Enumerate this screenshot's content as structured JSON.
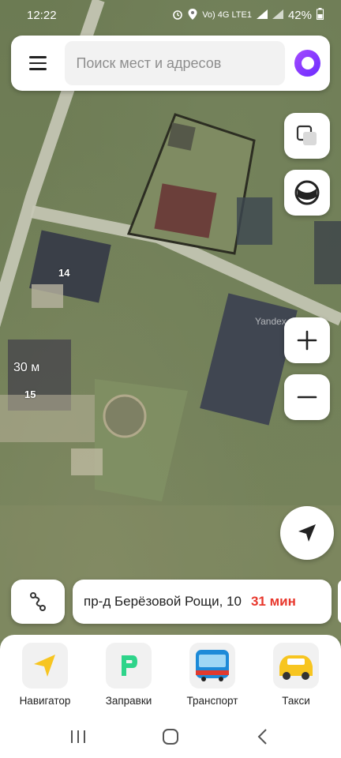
{
  "status_bar": {
    "time": "12:22",
    "network": "Vo) 4G LTE1",
    "battery": "42%"
  },
  "search": {
    "placeholder": "Поиск мест и адресов"
  },
  "map": {
    "house_labels": [
      "14",
      "15"
    ],
    "scale": "30 м",
    "watermark": "Yandex"
  },
  "route": {
    "destination": "пр-д Берёзовой Рощи, 10",
    "eta": "31 мин"
  },
  "services": [
    {
      "label": "Навигатор",
      "icon": "navigator-arrow-icon"
    },
    {
      "label": "Заправки",
      "icon": "fuel-icon"
    },
    {
      "label": "Транспорт",
      "icon": "bus-icon"
    },
    {
      "label": "Такси",
      "icon": "taxi-car-icon"
    }
  ],
  "colors": {
    "accent_red": "#e8372c",
    "alice_purple": "#7a35ff",
    "navigator_yellow": "#f7c520",
    "fuel_green": "#2ed48a"
  }
}
